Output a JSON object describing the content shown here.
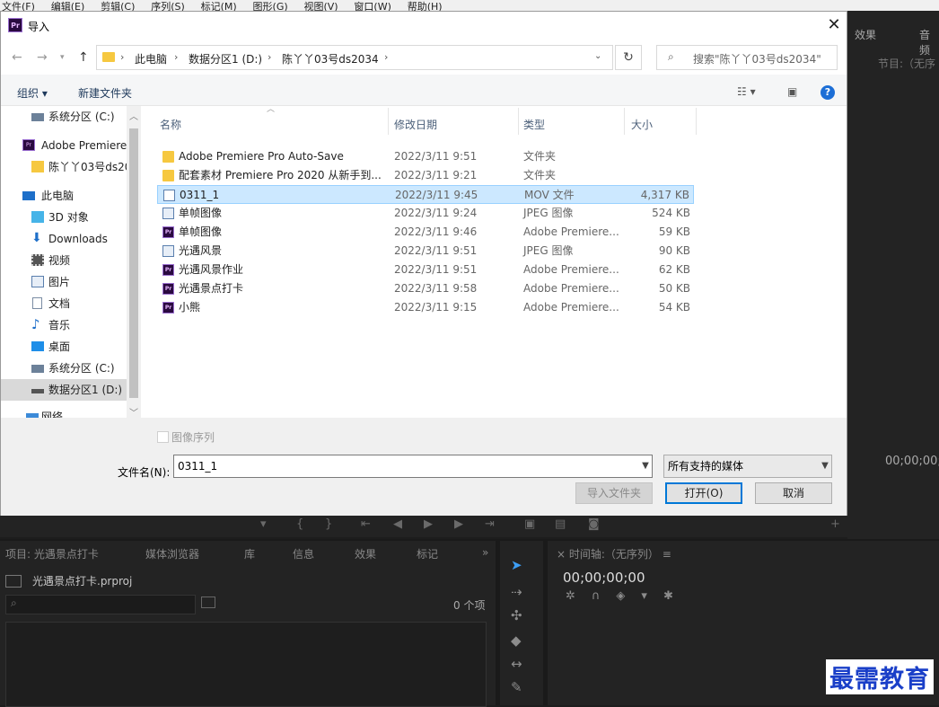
{
  "menubar": [
    "文件(F)",
    "编辑(E)",
    "剪辑(C)",
    "序列(S)",
    "标记(M)",
    "图形(G)",
    "视图(V)",
    "窗口(W)",
    "帮助(H)"
  ],
  "app": {
    "right_tabs": [
      "效果",
      "音频"
    ],
    "program_label": "节目:（无序",
    "program_timecode": "00;00;00;",
    "project_tabs": [
      "项目: 光遇景点打卡",
      "媒体浏览器",
      "库",
      "信息",
      "效果",
      "标记"
    ],
    "project_file": "光遇景点打卡.prproj",
    "item_count": "0 个项",
    "timeline_title": "时间轴:（无序列）",
    "timeline_timecode": "00;00;00;00",
    "watermark": "最需教育"
  },
  "dialog": {
    "title": "导入",
    "title_icon": "Pr",
    "breadcrumb": [
      "此电脑",
      "数据分区1 (D:)",
      "陈丫丫03号ds2034"
    ],
    "search_placeholder": "搜索\"陈丫丫03号ds2034\"",
    "toolbar": {
      "organize": "组织 ▾",
      "new_folder": "新建文件夹"
    },
    "nav_items": [
      {
        "label": "系统分区 (C:)",
        "icon": "drive-icon"
      },
      {
        "label": "Adobe Premiere",
        "icon": "premiere-icon"
      },
      {
        "label": "陈丫丫03号ds20",
        "icon": "folder-icon"
      },
      {
        "label": "此电脑",
        "icon": "computer-icon"
      },
      {
        "label": "3D 对象",
        "icon": "3d-objects-icon"
      },
      {
        "label": "Downloads",
        "icon": "download-icon"
      },
      {
        "label": "视频",
        "icon": "video-icon"
      },
      {
        "label": "图片",
        "icon": "pictures-icon"
      },
      {
        "label": "文档",
        "icon": "documents-icon"
      },
      {
        "label": "音乐",
        "icon": "music-icon"
      },
      {
        "label": "桌面",
        "icon": "desktop-icon"
      },
      {
        "label": "系统分区 (C:)",
        "icon": "drive-icon"
      },
      {
        "label": "数据分区1 (D:)",
        "icon": "drive-icon"
      },
      {
        "label": "网络",
        "icon": "network-icon"
      }
    ],
    "columns": {
      "name": "名称",
      "date": "修改日期",
      "type": "类型",
      "size": "大小"
    },
    "files": [
      {
        "name": "Adobe Premiere Pro Auto-Save",
        "date": "2022/3/11 9:51",
        "type": "文件夹",
        "size": "",
        "icon": "folder"
      },
      {
        "name": "配套素材 Premiere Pro 2020 从新手到...",
        "date": "2022/3/11 9:21",
        "type": "文件夹",
        "size": "",
        "icon": "folder"
      },
      {
        "name": "0311_1",
        "date": "2022/3/11 9:45",
        "type": "MOV 文件",
        "size": "4,317 KB",
        "icon": "mov"
      },
      {
        "name": "单帧图像",
        "date": "2022/3/11 9:24",
        "type": "JPEG 图像",
        "size": "524 KB",
        "icon": "img"
      },
      {
        "name": "单帧图像",
        "date": "2022/3/11 9:46",
        "type": "Adobe Premiere...",
        "size": "59 KB",
        "icon": "pr"
      },
      {
        "name": "光遇风景",
        "date": "2022/3/11 9:51",
        "type": "JPEG 图像",
        "size": "90 KB",
        "icon": "img"
      },
      {
        "name": "光遇风景作业",
        "date": "2022/3/11 9:51",
        "type": "Adobe Premiere...",
        "size": "62 KB",
        "icon": "pr"
      },
      {
        "name": "光遇景点打卡",
        "date": "2022/3/11 9:58",
        "type": "Adobe Premiere...",
        "size": "50 KB",
        "icon": "pr"
      },
      {
        "name": "小熊",
        "date": "2022/3/11 9:15",
        "type": "Adobe Premiere...",
        "size": "54 KB",
        "icon": "pr"
      }
    ],
    "selected_file": "0311_1",
    "image_sequence_label": "图像序列",
    "filename_label": "文件名(N):",
    "filename_value": "0311_1",
    "file_type": "所有支持的媒体",
    "buttons": {
      "import_folder": "导入文件夹",
      "open": "打开(O)",
      "cancel": "取消"
    }
  }
}
